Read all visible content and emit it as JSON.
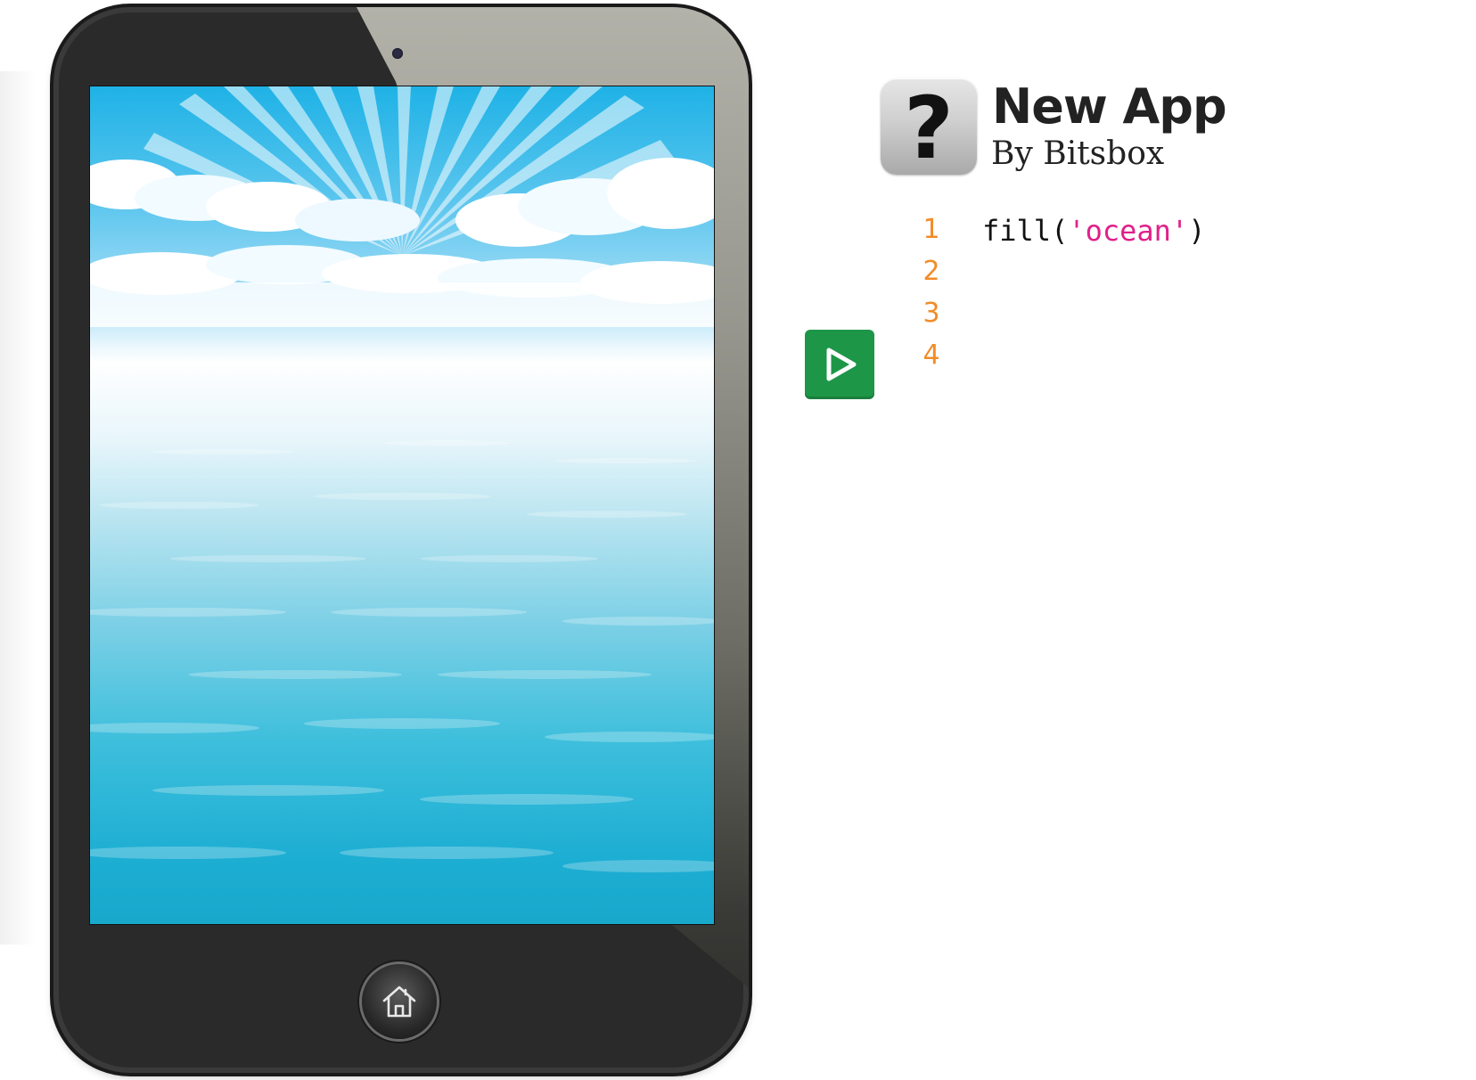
{
  "app": {
    "title": "New App",
    "author": "By Bitsbox",
    "icon_glyph": "?",
    "icon": "question-mark-icon"
  },
  "run_button": {
    "icon": "play-icon",
    "color": "#1e9647"
  },
  "editor": {
    "lines": [
      {
        "number": "1",
        "code_func": "fill(",
        "code_string": "'ocean'",
        "code_close": ")"
      },
      {
        "number": "2",
        "code_func": "",
        "code_string": "",
        "code_close": ""
      },
      {
        "number": "3",
        "code_func": "",
        "code_string": "",
        "code_close": ""
      },
      {
        "number": "4",
        "code_func": "",
        "code_string": "",
        "code_close": ""
      }
    ],
    "line_number_color": "#f28c28",
    "string_color": "#e0208a"
  },
  "device": {
    "scene": "ocean",
    "home_icon": "house-icon"
  }
}
